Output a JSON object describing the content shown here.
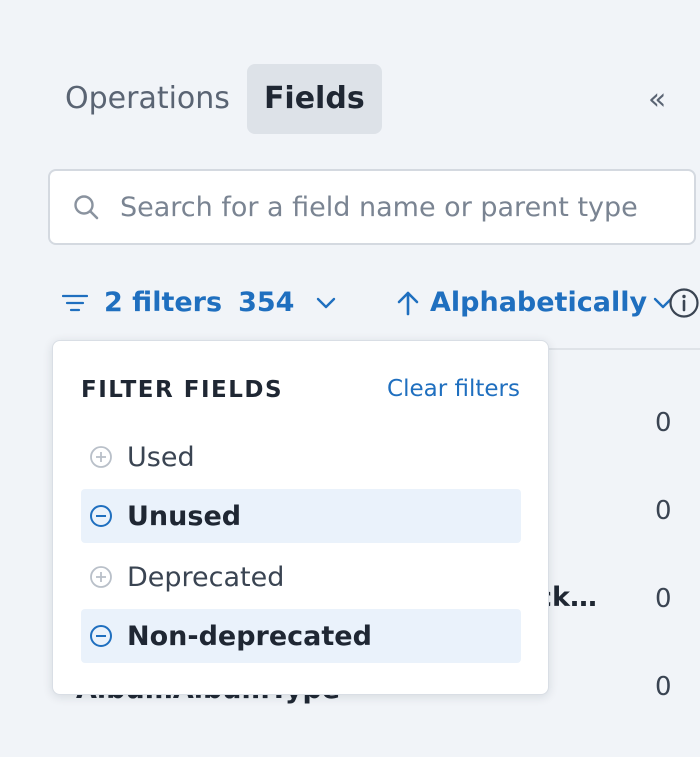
{
  "tabs": [
    {
      "label": "Operations",
      "active": false
    },
    {
      "label": "Fields",
      "active": true
    }
  ],
  "collapse_icon": "double-chevron-left-icon",
  "collapse_glyph": "«",
  "search": {
    "placeholder": "Search for a field name or parent type",
    "value": ""
  },
  "toolbar": {
    "filters_label": "2 filters",
    "filters_count": "354",
    "sort_label": "Alphabetically"
  },
  "list_values": [
    "0",
    "0",
    "0",
    "0"
  ],
  "list_peek": {
    "row3_text": "ck…",
    "row4_text": "AlbumAlbumType"
  },
  "filter_dropdown": {
    "title": "FILTER FIELDS",
    "clear_label": "Clear filters",
    "options": [
      {
        "label": "Used",
        "selected": false
      },
      {
        "label": "Unused",
        "selected": true
      },
      {
        "label": "Deprecated",
        "selected": false
      },
      {
        "label": "Non-deprecated",
        "selected": true
      }
    ]
  },
  "colors": {
    "accent": "#1f6fbf",
    "selected_bg": "#eaf2fb",
    "background": "#f1f4f8"
  }
}
